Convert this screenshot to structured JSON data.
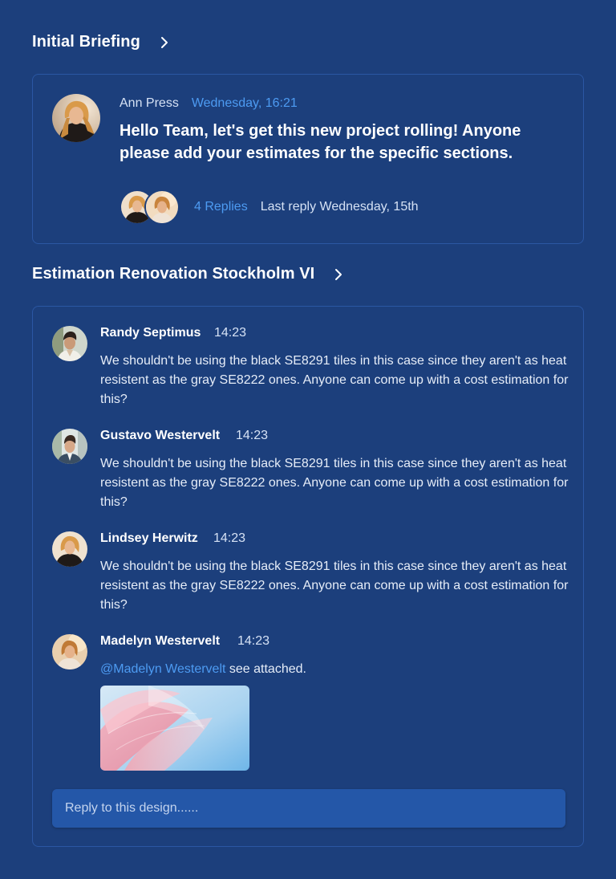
{
  "section1": {
    "title": "Initial Briefing",
    "post": {
      "author": "Ann Press",
      "time": "Wednesday, 16:21",
      "text": "Hello Team, let's get this new project rolling! Anyone please add your estimates for the specific sections.",
      "replies_count": "4 Replies",
      "last_reply": "Last reply Wednesday, 15th"
    }
  },
  "section2": {
    "title": "Estimation Renovation Stockholm VI",
    "messages": [
      {
        "name": "Randy Septimus",
        "time": "14:23",
        "text": "We shouldn't be using the black SE8291 tiles in this case since they aren't as heat resistent as the gray SE8222 ones. Anyone can come up with a cost estimation for this?"
      },
      {
        "name": "Gustavo Westervelt",
        "time": "14:23",
        "text": "We shouldn't be using the black SE8291 tiles in this case since they aren't as heat resistent as the gray SE8222 ones. Anyone can come up with a cost estimation for this?"
      },
      {
        "name": "Lindsey Herwitz",
        "time": "14:23",
        "text": "We shouldn't be using the black SE8291 tiles in this case since they aren't as heat resistent as the gray SE8222 ones. Anyone can come up with a cost estimation for this?"
      },
      {
        "name": "Madelyn Westervelt",
        "time": "14:23",
        "mention": "@Madelyn Westervelt",
        "text": " see attached."
      }
    ],
    "reply_placeholder": "Reply to this design......"
  },
  "icons": {
    "section_chevron": "chevron-right-icon"
  },
  "colors": {
    "background": "#1c3f7c",
    "card_border": "#2b57a3",
    "accent": "#4d9bf2",
    "input_bg": "#2457a8"
  }
}
